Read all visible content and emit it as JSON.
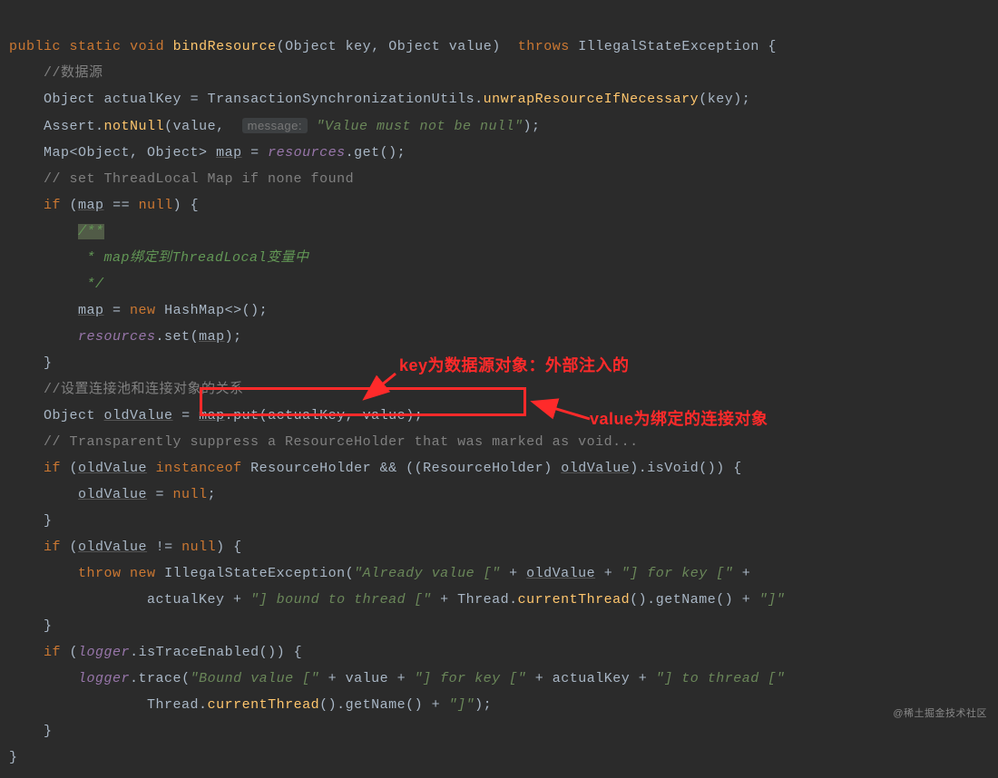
{
  "sig": {
    "public": "public",
    "static": "static",
    "void": "void",
    "name": "bindResource",
    "p1t": "Object",
    "p1n": "key",
    "p2t": "Object",
    "p2n": "value",
    "throws": "throws",
    "ex": "IllegalStateException"
  },
  "c1": "//数据源",
  "l2": {
    "type": "Object",
    "var": "actualKey",
    "cls": "TransactionSynchronizationUtils",
    "method": "unwrapResourceIfNecessary",
    "arg": "key"
  },
  "l3": {
    "cls": "Assert",
    "method": "notNull",
    "arg1": "value",
    "hint": "message:",
    "str": "\"Value must not be null\""
  },
  "l4": {
    "t1": "Map<Object, Object>",
    "var": "map",
    "field": "resources",
    "method": "get"
  },
  "c2": "// set ThreadLocal Map if none found",
  "l5": {
    "if": "if",
    "var": "map",
    "eq": "==",
    "null": "null"
  },
  "cb": {
    "open": "/**",
    "body": " * map绑定到ThreadLocal变量中",
    "close": " */"
  },
  "l6": {
    "var": "map",
    "new": "new",
    "cls": "HashMap<>"
  },
  "l7": {
    "field": "resources",
    "method": "set",
    "arg": "map"
  },
  "c3": "//设置连接池和连接对象的关系",
  "l8": {
    "type": "Object",
    "var": "oldValue",
    "map": "map",
    "method": "put",
    "a1": "actualKey",
    "a2": "value"
  },
  "c4": "// Transparently suppress a ResourceHolder that was marked as void...",
  "l9": {
    "if": "if",
    "var": "oldValue",
    "io": "instanceof",
    "cls": "ResourceHolder",
    "cast": "ResourceHolder",
    "var2": "oldValue",
    "m": "isVoid"
  },
  "l10": {
    "var": "oldValue",
    "null": "null"
  },
  "l11": {
    "if": "if",
    "var": "oldValue",
    "ne": "!=",
    "null": "null"
  },
  "l12": {
    "throw": "throw",
    "new": "new",
    "cls": "IllegalStateException",
    "s1": "\"Already value [\"",
    "var": "oldValue",
    "s2": "\"] for key [\"",
    "var2": "actualKey",
    "s3": "\"] bound to thread [\"",
    "cls2": "Thread",
    "m2": "currentThread",
    "m3": "getName",
    "s4": "\"]\""
  },
  "l13": {
    "if": "if",
    "field": "logger",
    "m": "isTraceEnabled"
  },
  "l14": {
    "field": "logger",
    "m": "trace",
    "s1": "\"Bound value [\"",
    "v1": "value",
    "s2": "\"] for key [\"",
    "v2": "actualKey",
    "s3": "\"] to thread [\"",
    "cls": "Thread",
    "m2": "currentThread",
    "m3": "getName",
    "s4": "\"]\""
  },
  "anno": {
    "key": "key为数据源对象：外部注入的",
    "value": "value为绑定的连接对象"
  },
  "watermark": "@稀土掘金技术社区"
}
